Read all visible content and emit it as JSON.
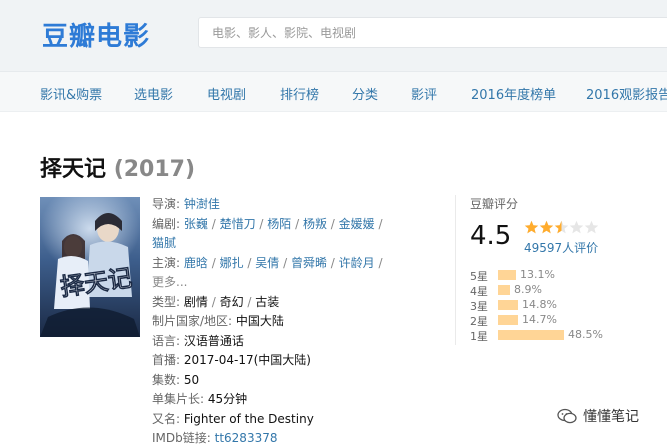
{
  "header": {
    "logo": "豆瓣电影",
    "search_placeholder": "电影、影人、影院、电视剧"
  },
  "nav": {
    "items": [
      "影讯&购票",
      "选电影",
      "电视剧",
      "排行榜",
      "分类",
      "影评",
      "2016年度榜单",
      "2016观影报告"
    ]
  },
  "movie": {
    "title": "择天记",
    "year": "(2017)",
    "poster_text": "择天记",
    "info": {
      "director_label": "导演:",
      "director": "钟澍佳",
      "writer_label": "编剧:",
      "writers": [
        "张巍",
        "楚惜刀",
        "杨陌",
        "杨叛",
        "金媛媛",
        "猫腻"
      ],
      "cast_label": "主演:",
      "cast": [
        "鹿晗",
        "娜扎",
        "吴倩",
        "曾舜晞",
        "许龄月"
      ],
      "more": "更多...",
      "genre_label": "类型:",
      "genres": [
        "剧情",
        "奇幻",
        "古装"
      ],
      "country_label": "制片国家/地区:",
      "country": "中国大陆",
      "language_label": "语言:",
      "language": "汉语普通话",
      "premiere_label": "首播:",
      "premiere": "2017-04-17(中国大陆)",
      "episodes_label": "集数:",
      "episodes": "50",
      "runtime_label": "单集片长:",
      "runtime": "45分钟",
      "aka_label": "又名:",
      "aka": "Fighter of the Destiny",
      "imdb_label": "IMDb链接:",
      "imdb": "tt6283378"
    }
  },
  "rating": {
    "title": "豆瓣评分",
    "score": "4.5",
    "stars_filled": 2.5,
    "count": "49597人评价",
    "star_color": "#ffac2d",
    "breakdown": [
      {
        "label": "5星",
        "pct": "13.1%",
        "value": 13.1
      },
      {
        "label": "4星",
        "pct": "8.9%",
        "value": 8.9
      },
      {
        "label": "3星",
        "pct": "14.8%",
        "value": 14.8
      },
      {
        "label": "2星",
        "pct": "14.7%",
        "value": 14.7
      },
      {
        "label": "1星",
        "pct": "48.5%",
        "value": 48.5
      }
    ]
  },
  "watermark": {
    "text": "懂懂笔记",
    "icon": "wechat-icon"
  }
}
